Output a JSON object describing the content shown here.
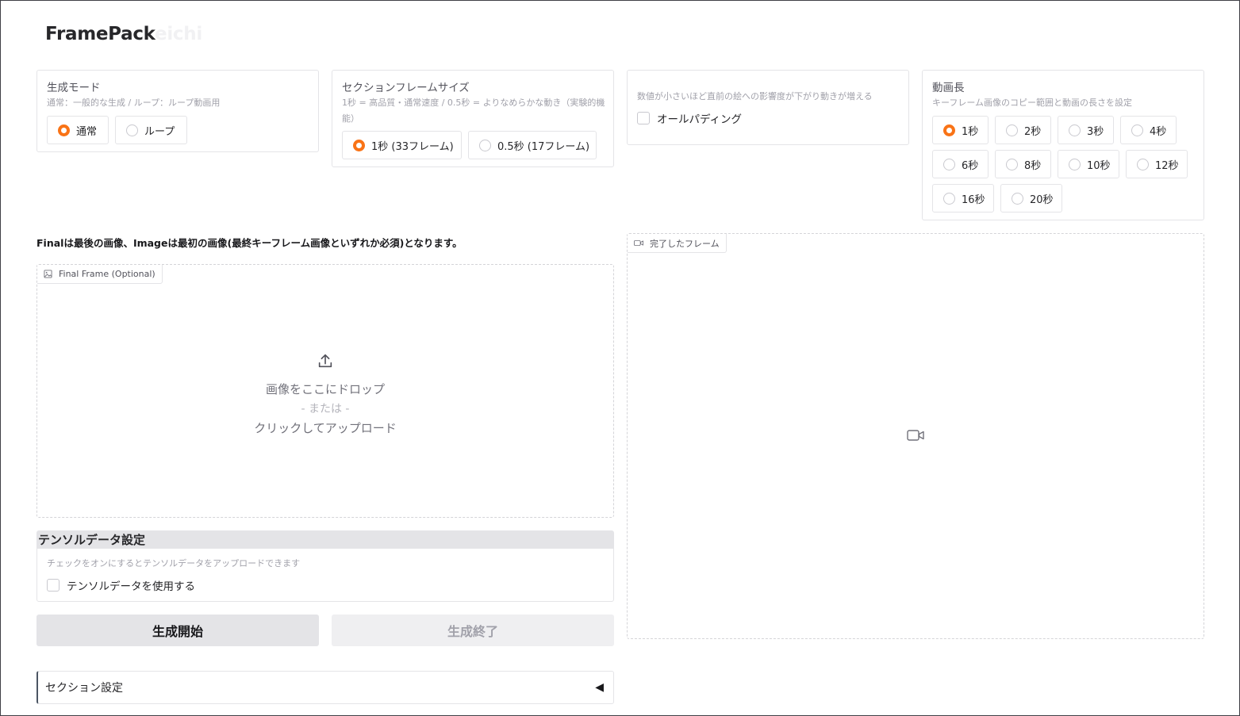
{
  "app": {
    "title": "FramePack",
    "title_suffix": "eichi"
  },
  "generation_mode": {
    "label": "生成モード",
    "info": "通常：一般的な生成 / ループ：ループ動画用",
    "options": [
      "通常",
      "ループ"
    ],
    "selected": "通常"
  },
  "section_frame_size": {
    "label": "セクションフレームサイズ",
    "info": "1秒 = 高品質・通常速度 / 0.5秒 = よりなめらかな動き（実験的機能）",
    "options": [
      "1秒 (33フレーム)",
      "0.5秒 (17フレーム)"
    ],
    "selected": "1秒 (33フレーム)"
  },
  "padding": {
    "info": "数値が小さいほど直前の絵への影響度が下がり動きが増える",
    "checkbox_label": "オールパディング",
    "checked": false
  },
  "video_length": {
    "label": "動画長",
    "info": "キーフレーム画像のコピー範囲と動画の長さを設定",
    "options": [
      "1秒",
      "2秒",
      "3秒",
      "4秒",
      "6秒",
      "8秒",
      "10秒",
      "12秒",
      "16秒",
      "20秒"
    ],
    "selected": "1秒"
  },
  "note": "Finalは最後の画像、Imageは最初の画像(最終キーフレーム画像といずれか必須)となります。",
  "final_frame": {
    "tag": "Final Frame (Optional)",
    "drop_text": "画像をここにドロップ",
    "or_text": "- または -",
    "click_text": "クリックしてアップロード",
    "icons": {
      "tag": "image-icon",
      "upload": "upload-icon"
    }
  },
  "tensor": {
    "header": "テンソルデータ設定",
    "info": "チェックをオンにするとテンソルデータをアップロードできます",
    "checkbox_label": "テンソルデータを使用する",
    "checked": false
  },
  "buttons": {
    "start": "生成開始",
    "end": "生成終了"
  },
  "section_settings": {
    "label": "セクション設定",
    "toggle": "◀"
  },
  "completed_frames": {
    "tag": "完了したフレーム",
    "icons": {
      "tag": "video-icon",
      "placeholder": "video-icon"
    }
  },
  "colors": {
    "accent": "#f97316",
    "border": "#e4e4e7",
    "button_bg": "#e4e4e7"
  }
}
